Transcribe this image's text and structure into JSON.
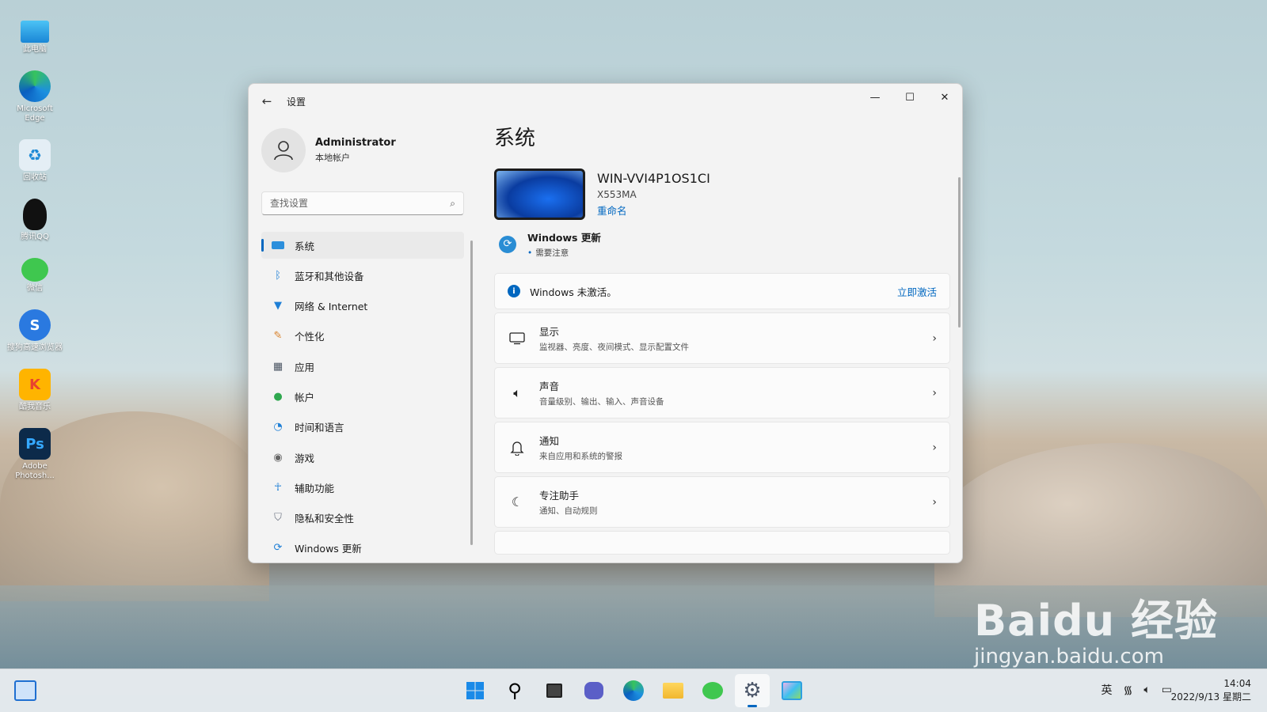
{
  "desktop": {
    "icons": [
      {
        "label": "此电脑",
        "icon": "computer-icon",
        "color": "#2aa3e8"
      },
      {
        "label": "Microsoft Edge",
        "icon": "edge-icon",
        "color": "#1b8ad3"
      },
      {
        "label": "回收站",
        "icon": "recycle-bin-icon",
        "color": "#d9e6ef"
      },
      {
        "label": "腾讯QQ",
        "icon": "qq-icon",
        "color": "#111111"
      },
      {
        "label": "微信",
        "icon": "wechat-icon",
        "color": "#3fc74f"
      },
      {
        "label": "搜狗高速浏览器",
        "icon": "sogou-browser-icon",
        "color": "#2a79e0"
      },
      {
        "label": "酷我音乐",
        "icon": "kuwo-music-icon",
        "color": "#ffb400"
      },
      {
        "label": "Adobe Photosh...",
        "icon": "photoshop-icon",
        "color": "#0c2a4a",
        "glyph": "Ps"
      }
    ]
  },
  "window": {
    "title": "设置",
    "back_icon": "back-arrow-icon",
    "controls": {
      "minimize": "—",
      "maximize": "☐",
      "close": "✕"
    }
  },
  "user": {
    "name": "Administrator",
    "account_type": "本地帐户"
  },
  "search": {
    "placeholder": "查找设置",
    "icon": "search-icon"
  },
  "nav": {
    "items": [
      {
        "label": "系统",
        "icon": "system-icon",
        "active": true
      },
      {
        "label": "蓝牙和其他设备",
        "icon": "bluetooth-icon"
      },
      {
        "label": "网络 & Internet",
        "icon": "network-icon"
      },
      {
        "label": "个性化",
        "icon": "personalization-icon"
      },
      {
        "label": "应用",
        "icon": "apps-icon"
      },
      {
        "label": "帐户",
        "icon": "accounts-icon"
      },
      {
        "label": "时间和语言",
        "icon": "time-language-icon"
      },
      {
        "label": "游戏",
        "icon": "gaming-icon"
      },
      {
        "label": "辅助功能",
        "icon": "accessibility-icon"
      },
      {
        "label": "隐私和安全性",
        "icon": "privacy-icon"
      },
      {
        "label": "Windows 更新",
        "icon": "windows-update-icon"
      }
    ]
  },
  "main": {
    "title": "系统",
    "device": {
      "name": "WIN-VVI4P1OS1CI",
      "model": "X553MA",
      "rename_label": "重命名"
    },
    "update": {
      "title": "Windows 更新",
      "status": "需要注意"
    },
    "activation": {
      "message": "Windows 未激活。",
      "action": "立即激活"
    },
    "cards": [
      {
        "title": "显示",
        "subtitle": "监视器、亮度、夜间模式、显示配置文件",
        "icon": "display-icon"
      },
      {
        "title": "声音",
        "subtitle": "音量级别、输出、输入、声音设备",
        "icon": "sound-icon"
      },
      {
        "title": "通知",
        "subtitle": "来自应用和系统的警报",
        "icon": "notification-bell-icon"
      },
      {
        "title": "专注助手",
        "subtitle": "通知、自动规则",
        "icon": "focus-assist-moon-icon"
      }
    ]
  },
  "taskbar": {
    "apps": [
      {
        "name": "start",
        "icon": "windows-start-icon"
      },
      {
        "name": "search",
        "icon": "search-icon"
      },
      {
        "name": "task-view",
        "icon": "task-view-icon"
      },
      {
        "name": "chat",
        "icon": "teams-chat-icon"
      },
      {
        "name": "edge",
        "icon": "edge-icon"
      },
      {
        "name": "file-explorer",
        "icon": "folder-icon"
      },
      {
        "name": "wechat",
        "icon": "wechat-icon"
      },
      {
        "name": "settings",
        "icon": "gear-icon",
        "active": true
      },
      {
        "name": "photos",
        "icon": "photos-icon"
      }
    ],
    "tray": {
      "language": "英",
      "wifi_icon": "wifi-icon",
      "volume_icon": "volume-icon",
      "battery_icon": "battery-icon"
    },
    "clock": {
      "time": "14:04",
      "date": "2022/9/13 星期二"
    }
  },
  "watermark": {
    "brand": "Baidu 经验",
    "url": "jingyan.baidu.com"
  }
}
